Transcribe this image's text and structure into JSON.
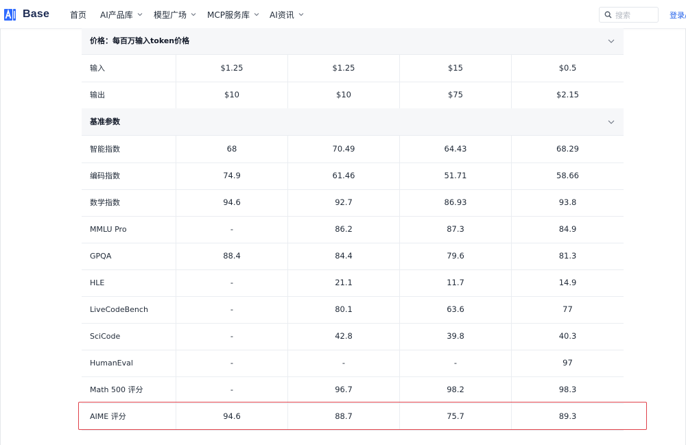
{
  "header": {
    "logo_text": "Base",
    "nav": [
      {
        "label": "首页",
        "has_dropdown": false
      },
      {
        "label": "AI产品库",
        "has_dropdown": true
      },
      {
        "label": "模型广场",
        "has_dropdown": true
      },
      {
        "label": "MCP服务库",
        "has_dropdown": true
      },
      {
        "label": "AI资讯",
        "has_dropdown": true
      }
    ],
    "search_placeholder": "搜索",
    "login_label": "登录/"
  },
  "sections": {
    "price": {
      "title": "价格：每百万输入token价格",
      "rows": [
        {
          "label": "输入",
          "values": [
            "$1.25",
            "$1.25",
            "$15",
            "$0.5"
          ]
        },
        {
          "label": "输出",
          "values": [
            "$10",
            "$10",
            "$75",
            "$2.15"
          ]
        }
      ]
    },
    "bench": {
      "title": "基准参数",
      "rows": [
        {
          "label": "智能指数",
          "values": [
            "68",
            "70.49",
            "64.43",
            "68.29"
          ]
        },
        {
          "label": "编码指数",
          "values": [
            "74.9",
            "61.46",
            "51.71",
            "58.66"
          ]
        },
        {
          "label": "数学指数",
          "values": [
            "94.6",
            "92.7",
            "86.93",
            "93.8"
          ]
        },
        {
          "label": "MMLU Pro",
          "values": [
            "-",
            "86.2",
            "87.3",
            "84.9"
          ]
        },
        {
          "label": "GPQA",
          "values": [
            "88.4",
            "84.4",
            "79.6",
            "81.3"
          ]
        },
        {
          "label": "HLE",
          "values": [
            "-",
            "21.1",
            "11.7",
            "14.9"
          ]
        },
        {
          "label": "LiveCodeBench",
          "values": [
            "-",
            "80.1",
            "63.6",
            "77"
          ]
        },
        {
          "label": "SciCode",
          "values": [
            "-",
            "42.8",
            "39.8",
            "40.3"
          ]
        },
        {
          "label": "HumanEval",
          "values": [
            "-",
            "-",
            "-",
            "97"
          ]
        },
        {
          "label": "Math 500 评分",
          "values": [
            "-",
            "96.7",
            "98.2",
            "98.3"
          ]
        },
        {
          "label": "AIME 评分",
          "values": [
            "94.6",
            "88.7",
            "75.7",
            "89.3"
          ]
        }
      ]
    }
  },
  "colors": {
    "highlight_border": "#e0414a",
    "link": "#2563eb",
    "logo_blue": "#2f6bff",
    "section_bg": "#f6f7f9"
  }
}
